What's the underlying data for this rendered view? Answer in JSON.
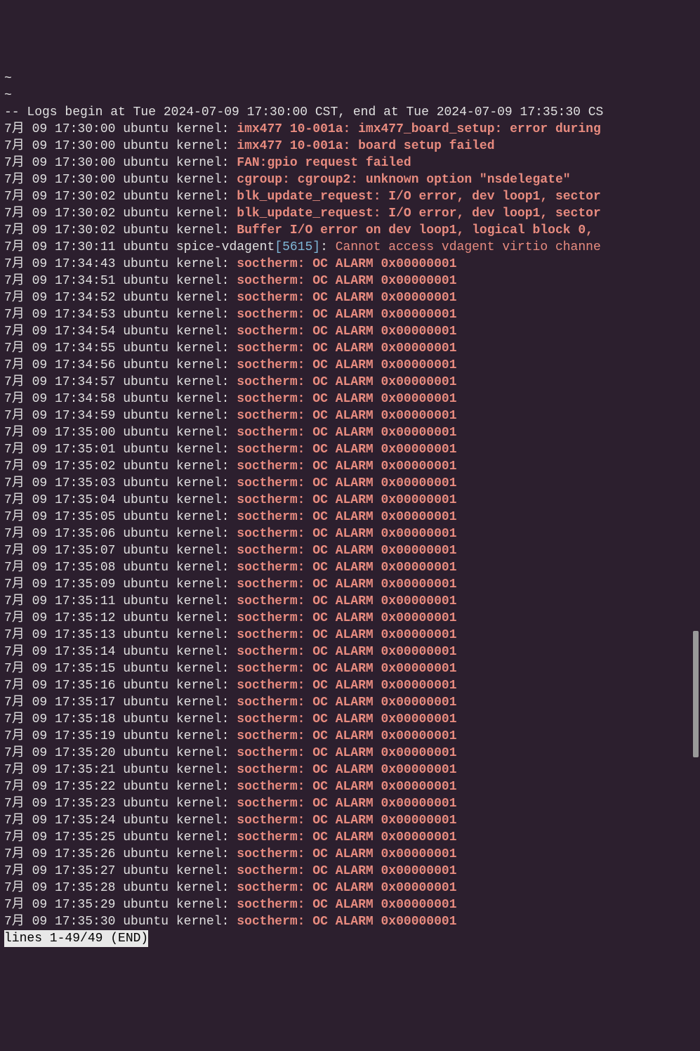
{
  "tilde1": "~",
  "tilde2": "~",
  "header": "-- Logs begin at Tue 2024-07-09 17:30:00 CST, end at Tue 2024-07-09 17:35:30 CS",
  "status": "lines 1-49/49 (END)",
  "lines": [
    {
      "prefix": "7月 09 17:30:00 ubuntu kernel: ",
      "msg": "imx477 10-001a: imx477_board_setup: error during",
      "bold": true
    },
    {
      "prefix": "7月 09 17:30:00 ubuntu kernel: ",
      "msg": "imx477 10-001a: board setup failed",
      "bold": true
    },
    {
      "prefix": "7月 09 17:30:00 ubuntu kernel: ",
      "msg": "FAN:gpio request failed",
      "bold": true
    },
    {
      "prefix": "7月 09 17:30:00 ubuntu kernel: ",
      "msg": "cgroup: cgroup2: unknown option \"nsdelegate\"",
      "bold": true
    },
    {
      "prefix": "7月 09 17:30:02 ubuntu kernel: ",
      "msg": "blk_update_request: I/O error, dev loop1, sector",
      "bold": true
    },
    {
      "prefix": "7月 09 17:30:02 ubuntu kernel: ",
      "msg": "blk_update_request: I/O error, dev loop1, sector",
      "bold": true
    },
    {
      "prefix": "7月 09 17:30:02 ubuntu kernel: ",
      "msg": "Buffer I/O error on dev loop1, logical block 0,",
      "bold": true
    },
    {
      "prefix": "7月 09 17:30:11 ubuntu spice-vdagent",
      "pid": "[5615]",
      "suffix": ": ",
      "msg": "Cannot access vdagent virtio channe",
      "bold": false
    },
    {
      "prefix": "7月 09 17:34:43 ubuntu kernel: ",
      "msg": "soctherm: OC ALARM 0x00000001",
      "bold": true
    },
    {
      "prefix": "7月 09 17:34:51 ubuntu kernel: ",
      "msg": "soctherm: OC ALARM 0x00000001",
      "bold": true
    },
    {
      "prefix": "7月 09 17:34:52 ubuntu kernel: ",
      "msg": "soctherm: OC ALARM 0x00000001",
      "bold": true
    },
    {
      "prefix": "7月 09 17:34:53 ubuntu kernel: ",
      "msg": "soctherm: OC ALARM 0x00000001",
      "bold": true
    },
    {
      "prefix": "7月 09 17:34:54 ubuntu kernel: ",
      "msg": "soctherm: OC ALARM 0x00000001",
      "bold": true
    },
    {
      "prefix": "7月 09 17:34:55 ubuntu kernel: ",
      "msg": "soctherm: OC ALARM 0x00000001",
      "bold": true
    },
    {
      "prefix": "7月 09 17:34:56 ubuntu kernel: ",
      "msg": "soctherm: OC ALARM 0x00000001",
      "bold": true
    },
    {
      "prefix": "7月 09 17:34:57 ubuntu kernel: ",
      "msg": "soctherm: OC ALARM 0x00000001",
      "bold": true
    },
    {
      "prefix": "7月 09 17:34:58 ubuntu kernel: ",
      "msg": "soctherm: OC ALARM 0x00000001",
      "bold": true
    },
    {
      "prefix": "7月 09 17:34:59 ubuntu kernel: ",
      "msg": "soctherm: OC ALARM 0x00000001",
      "bold": true
    },
    {
      "prefix": "7月 09 17:35:00 ubuntu kernel: ",
      "msg": "soctherm: OC ALARM 0x00000001",
      "bold": true
    },
    {
      "prefix": "7月 09 17:35:01 ubuntu kernel: ",
      "msg": "soctherm: OC ALARM 0x00000001",
      "bold": true
    },
    {
      "prefix": "7月 09 17:35:02 ubuntu kernel: ",
      "msg": "soctherm: OC ALARM 0x00000001",
      "bold": true
    },
    {
      "prefix": "7月 09 17:35:03 ubuntu kernel: ",
      "msg": "soctherm: OC ALARM 0x00000001",
      "bold": true
    },
    {
      "prefix": "7月 09 17:35:04 ubuntu kernel: ",
      "msg": "soctherm: OC ALARM 0x00000001",
      "bold": true
    },
    {
      "prefix": "7月 09 17:35:05 ubuntu kernel: ",
      "msg": "soctherm: OC ALARM 0x00000001",
      "bold": true
    },
    {
      "prefix": "7月 09 17:35:06 ubuntu kernel: ",
      "msg": "soctherm: OC ALARM 0x00000001",
      "bold": true
    },
    {
      "prefix": "7月 09 17:35:07 ubuntu kernel: ",
      "msg": "soctherm: OC ALARM 0x00000001",
      "bold": true
    },
    {
      "prefix": "7月 09 17:35:08 ubuntu kernel: ",
      "msg": "soctherm: OC ALARM 0x00000001",
      "bold": true
    },
    {
      "prefix": "7月 09 17:35:09 ubuntu kernel: ",
      "msg": "soctherm: OC ALARM 0x00000001",
      "bold": true
    },
    {
      "prefix": "7月 09 17:35:11 ubuntu kernel: ",
      "msg": "soctherm: OC ALARM 0x00000001",
      "bold": true
    },
    {
      "prefix": "7月 09 17:35:12 ubuntu kernel: ",
      "msg": "soctherm: OC ALARM 0x00000001",
      "bold": true
    },
    {
      "prefix": "7月 09 17:35:13 ubuntu kernel: ",
      "msg": "soctherm: OC ALARM 0x00000001",
      "bold": true
    },
    {
      "prefix": "7月 09 17:35:14 ubuntu kernel: ",
      "msg": "soctherm: OC ALARM 0x00000001",
      "bold": true
    },
    {
      "prefix": "7月 09 17:35:15 ubuntu kernel: ",
      "msg": "soctherm: OC ALARM 0x00000001",
      "bold": true
    },
    {
      "prefix": "7月 09 17:35:16 ubuntu kernel: ",
      "msg": "soctherm: OC ALARM 0x00000001",
      "bold": true
    },
    {
      "prefix": "7月 09 17:35:17 ubuntu kernel: ",
      "msg": "soctherm: OC ALARM 0x00000001",
      "bold": true
    },
    {
      "prefix": "7月 09 17:35:18 ubuntu kernel: ",
      "msg": "soctherm: OC ALARM 0x00000001",
      "bold": true
    },
    {
      "prefix": "7月 09 17:35:19 ubuntu kernel: ",
      "msg": "soctherm: OC ALARM 0x00000001",
      "bold": true
    },
    {
      "prefix": "7月 09 17:35:20 ubuntu kernel: ",
      "msg": "soctherm: OC ALARM 0x00000001",
      "bold": true
    },
    {
      "prefix": "7月 09 17:35:21 ubuntu kernel: ",
      "msg": "soctherm: OC ALARM 0x00000001",
      "bold": true
    },
    {
      "prefix": "7月 09 17:35:22 ubuntu kernel: ",
      "msg": "soctherm: OC ALARM 0x00000001",
      "bold": true
    },
    {
      "prefix": "7月 09 17:35:23 ubuntu kernel: ",
      "msg": "soctherm: OC ALARM 0x00000001",
      "bold": true
    },
    {
      "prefix": "7月 09 17:35:24 ubuntu kernel: ",
      "msg": "soctherm: OC ALARM 0x00000001",
      "bold": true
    },
    {
      "prefix": "7月 09 17:35:25 ubuntu kernel: ",
      "msg": "soctherm: OC ALARM 0x00000001",
      "bold": true
    },
    {
      "prefix": "7月 09 17:35:26 ubuntu kernel: ",
      "msg": "soctherm: OC ALARM 0x00000001",
      "bold": true
    },
    {
      "prefix": "7月 09 17:35:27 ubuntu kernel: ",
      "msg": "soctherm: OC ALARM 0x00000001",
      "bold": true
    },
    {
      "prefix": "7月 09 17:35:28 ubuntu kernel: ",
      "msg": "soctherm: OC ALARM 0x00000001",
      "bold": true
    },
    {
      "prefix": "7月 09 17:35:29 ubuntu kernel: ",
      "msg": "soctherm: OC ALARM 0x00000001",
      "bold": true
    },
    {
      "prefix": "7月 09 17:35:30 ubuntu kernel: ",
      "msg": "soctherm: OC ALARM 0x00000001",
      "bold": true
    }
  ]
}
